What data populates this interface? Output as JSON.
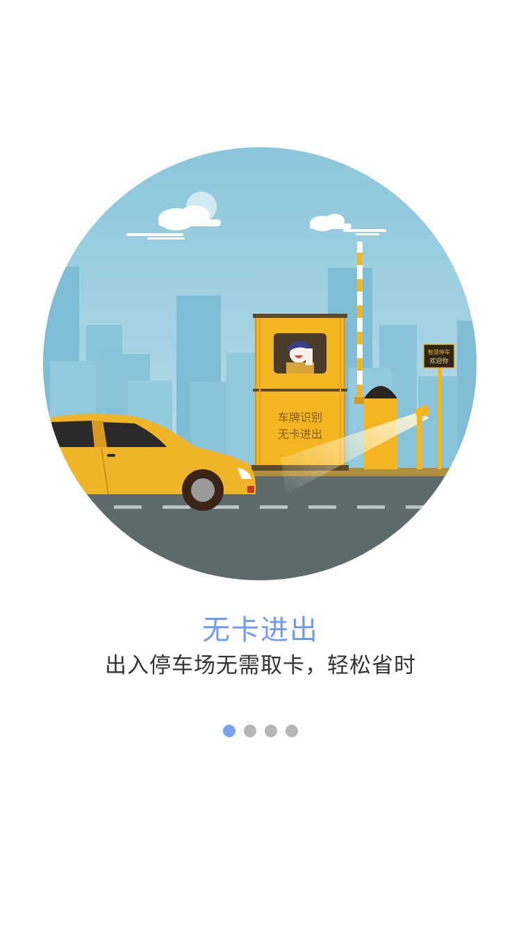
{
  "colors": {
    "accent": "#7ca2f4",
    "title": "#6f9cf2",
    "subtitle": "#333333",
    "dot_inactive": "#b5b5b5",
    "sky": "#a9d3e3",
    "road": "#5c6a6c",
    "car": "#f0b429"
  },
  "illustration": {
    "booth_text_line1": "车牌识别",
    "booth_text_line2": "无卡进出",
    "sign_line1": "智慧停车",
    "sign_line2": "欢迎你"
  },
  "slide": {
    "title": "无卡进出",
    "subtitle": "出入停车场无需取卡，轻松省时"
  },
  "pager": {
    "total": 4,
    "active_index": 0
  }
}
